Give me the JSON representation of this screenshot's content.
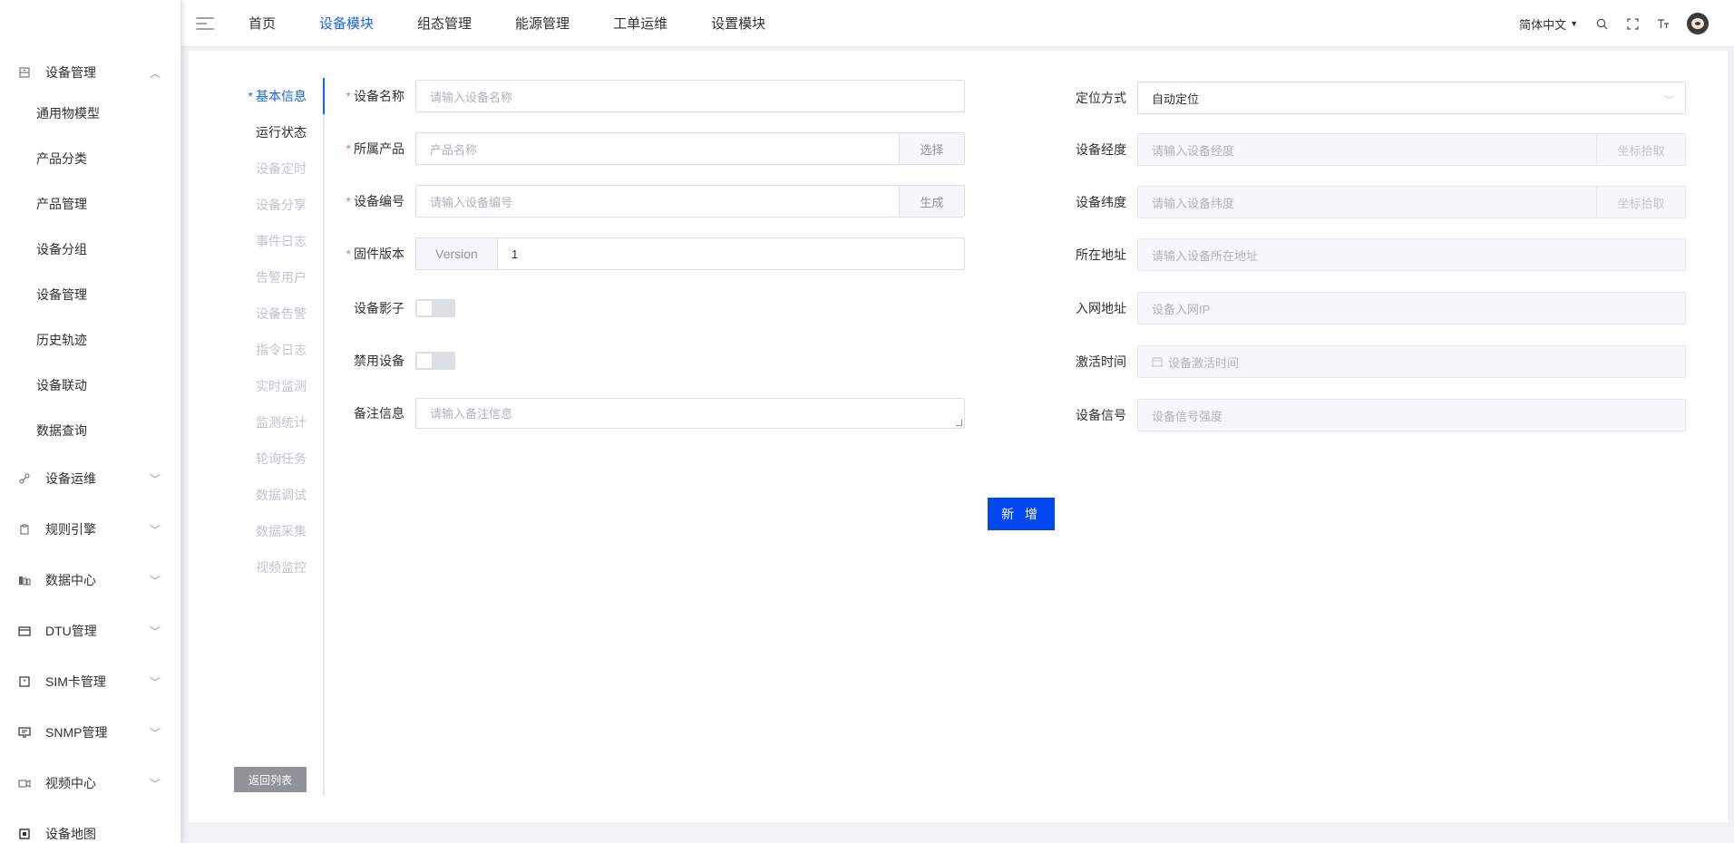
{
  "sidebar": {
    "groups": [
      {
        "label": "设备管理",
        "open": true,
        "items": [
          "通用物模型",
          "产品分类",
          "产品管理",
          "设备分组",
          "设备管理",
          "历史轨迹",
          "设备联动",
          "数据查询"
        ]
      },
      {
        "label": "设备运维"
      },
      {
        "label": "规则引擎"
      },
      {
        "label": "数据中心"
      },
      {
        "label": "DTU管理"
      },
      {
        "label": "SIM卡管理"
      },
      {
        "label": "SNMP管理"
      },
      {
        "label": "视频中心"
      },
      {
        "label": "设备地图"
      }
    ]
  },
  "header": {
    "nav": [
      "首页",
      "设备模块",
      "组态管理",
      "能源管理",
      "工单运维",
      "设置模块"
    ],
    "active_nav": "设备模块",
    "lang": "简体中文"
  },
  "tabs": {
    "items": [
      "基本信息",
      "运行状态",
      "设备定时",
      "设备分享",
      "事件日志",
      "告警用户",
      "设备告警",
      "指令日志",
      "实时监测",
      "监测统计",
      "轮询任务",
      "数据调试",
      "数据采集",
      "视频监控"
    ],
    "active": "基本信息",
    "back_label": "返回列表"
  },
  "form": {
    "device_name": {
      "label": "设备名称",
      "placeholder": "请输入设备名称"
    },
    "product": {
      "label": "所属产品",
      "placeholder": "产品名称",
      "button": "选择"
    },
    "serial": {
      "label": "设备编号",
      "placeholder": "请输入设备编号",
      "button": "生成"
    },
    "firmware": {
      "label": "固件版本",
      "prefix": "Version",
      "value": "1"
    },
    "shadow": {
      "label": "设备影子",
      "on": false
    },
    "disable": {
      "label": "禁用设备",
      "on": false
    },
    "remark": {
      "label": "备注信息",
      "placeholder": "请输入备注信息"
    },
    "locate": {
      "label": "定位方式",
      "value": "自动定位"
    },
    "longitude": {
      "label": "设备经度",
      "placeholder": "请输入设备经度",
      "button": "坐标拾取"
    },
    "latitude": {
      "label": "设备纬度",
      "placeholder": "请输入设备纬度",
      "button": "坐标拾取"
    },
    "address": {
      "label": "所在地址",
      "placeholder": "请输入设备所在地址"
    },
    "ip": {
      "label": "入网地址",
      "placeholder": "设备入网IP"
    },
    "activate": {
      "label": "激活时间",
      "placeholder": "设备激活时间"
    },
    "signal": {
      "label": "设备信号",
      "placeholder": "设备信号强度"
    },
    "submit_label": "新 增"
  }
}
